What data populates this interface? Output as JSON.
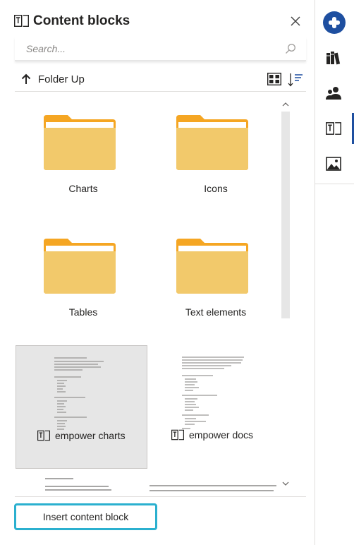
{
  "header": {
    "title": "Content blocks",
    "title_icon": "content-block-icon",
    "close_icon": "close-icon"
  },
  "search": {
    "placeholder": "Search...",
    "value": ""
  },
  "toolbar": {
    "folder_up_label": "Folder Up",
    "view_icon": "grid-view-icon",
    "sort_icon": "sort-icon"
  },
  "folders": [
    {
      "label": "Charts"
    },
    {
      "label": "Icons"
    },
    {
      "label": "Tables"
    },
    {
      "label": "Text elements"
    }
  ],
  "templates": [
    {
      "label": "empower charts",
      "selected": true
    },
    {
      "label": "empower docs",
      "selected": false
    }
  ],
  "insert_button": {
    "label": "Insert content block"
  },
  "rail": {
    "items": [
      "app-logo-icon",
      "library-icon",
      "people-icon",
      "content-block-icon",
      "image-icon"
    ],
    "active": "content-block-icon"
  },
  "colors": {
    "folder": "#f2c96b",
    "folder_tab": "#f5a623",
    "accent": "#1e4fa0",
    "focus": "#2bb0cf"
  }
}
